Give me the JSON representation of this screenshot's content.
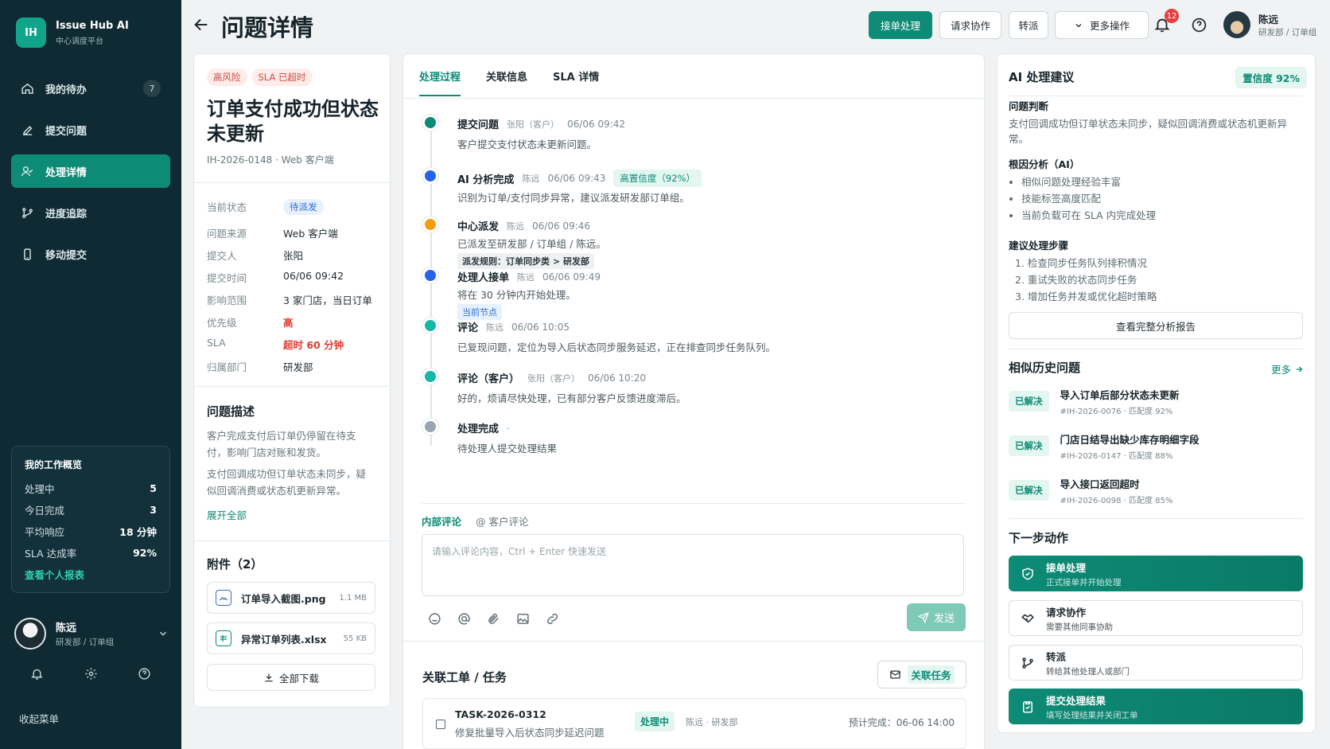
{
  "app": {
    "logo": "IH",
    "name": "Issue Hub AI",
    "subtitle": "中心调度平台"
  },
  "nav": [
    {
      "label": "我的待办",
      "icon": "home-icon",
      "badge": "7"
    },
    {
      "label": "提交问题",
      "icon": "pen-icon",
      "badge": ""
    },
    {
      "label": "处理详情",
      "icon": "user-check-icon",
      "badge": ""
    },
    {
      "label": "进度追踪",
      "icon": "branch-icon",
      "badge": ""
    },
    {
      "label": "移动提交",
      "icon": "mobile-icon",
      "badge": ""
    }
  ],
  "work": {
    "title": "我的工作概览",
    "rows": [
      {
        "label": "处理中",
        "value": "5"
      },
      {
        "label": "今日完成",
        "value": "3"
      },
      {
        "label": "平均响应",
        "value": "18 分钟"
      },
      {
        "label": "SLA 达成率",
        "value": "92%"
      }
    ],
    "link": "查看个人报表"
  },
  "user": {
    "name": "陈远",
    "dept": "研发部 / 订单组"
  },
  "sidebar_collapse": "收起菜单",
  "header": {
    "title": "问题详情",
    "btn_accept": "接单处理",
    "btn_collab": "请求协作",
    "btn_transfer": "转派",
    "btn_more": "更多操作",
    "notif_count": "12"
  },
  "issue": {
    "tags": [
      "高风险",
      "SLA 已超时"
    ],
    "title": "订单支付成功但状态未更新",
    "id": "IH-2026-0148 · Web 客户端",
    "props": [
      {
        "label": "当前状态",
        "value": "待派发"
      },
      {
        "label": "问题来源",
        "value": "Web 客户端"
      },
      {
        "label": "提交人",
        "value": "张阳"
      },
      {
        "label": "提交时间",
        "value": "06/06 09:42"
      },
      {
        "label": "影响范围",
        "value": "3 家门店，当日订单"
      },
      {
        "label": "优先级",
        "value": "高"
      },
      {
        "label": "SLA",
        "value": "超时 60 分钟"
      },
      {
        "label": "归属部门",
        "value": "研发部"
      }
    ],
    "desc_title": "问题描述",
    "desc1": "客户完成支付后订单仍停留在待支付，影响门店对账和发货。",
    "desc2": "支付回调成功但订单状态未同步，疑似回调消费或状态机更新异常。",
    "expand": "展开全部",
    "attach_title": "附件（2）",
    "attachments": [
      {
        "name": "订单导入截图.png",
        "size": "1.1 MB"
      },
      {
        "name": "异常订单列表.xlsx",
        "size": "55 KB"
      }
    ],
    "download_all": "全部下载"
  },
  "tabs": [
    "处理过程",
    "关联信息",
    "SLA 详情"
  ],
  "timeline": [
    {
      "title": "提交问题",
      "who": "张阳（客户）",
      "time": "06/06 09:42",
      "text": "客户提交支付状态未更新问题。",
      "color": "#0d8b76",
      "extra": ""
    },
    {
      "title": "AI 分析完成",
      "who": "陈远",
      "time": "06/06 09:43",
      "text": "识别为订单/支付同步异常，建议派发研发部订单组。",
      "color": "#2563eb",
      "extra": "高置信度（92%）"
    },
    {
      "title": "中心派发",
      "who": "陈远",
      "time": "06/06 09:46",
      "text": "已派发至研发部 / 订单组 / 陈远。",
      "color": "#f59e0b",
      "extra": "派发规则：订单同步类 > 研发部"
    },
    {
      "title": "处理人接单",
      "who": "陈远",
      "time": "06/06 09:49",
      "text": "将在 30 分钟内开始处理。",
      "color": "#2563eb",
      "extra": "当前节点"
    },
    {
      "title": "评论",
      "who": "陈远",
      "time": "06/06 10:05",
      "text": "已复现问题，定位为导入后状态同步服务延迟，正在排查同步任务队列。",
      "color": "#14b8a6",
      "extra": ""
    },
    {
      "title": "评论（客户）",
      "who": "张阳（客户）",
      "time": "06/06 10:20",
      "text": "好的，烦请尽快处理，已有部分客户反馈进度滞后。",
      "color": "#14b8a6",
      "extra": ""
    },
    {
      "title": "处理完成",
      "who": "-",
      "time": "",
      "text": "待处理人提交处理结果",
      "color": "#9aa5b4",
      "extra": ""
    }
  ],
  "comment": {
    "tab_internal": "内部评论",
    "tab_customer": "@ 客户评论",
    "placeholder": "请输入评论内容，Ctrl + Enter 快速发送",
    "send": "发送"
  },
  "related": {
    "title": "关联工单 / 任务",
    "btn": "关联任务",
    "task_id": "TASK-2026-0312",
    "task_desc": "修复批量导入后状态同步延迟问题",
    "task_status": "处理中",
    "task_owner": "陈远 · 研发部",
    "task_eta": "预计完成：06-06 14:00"
  },
  "ai": {
    "title": "AI 处理建议",
    "confidence": "置信度 92%",
    "judge_title": "问题判断",
    "judge": "支付回调成功但订单状态未同步，疑似回调消费或状态机更新异常。",
    "root_title": "根因分析（AI）",
    "root": [
      "相似问题处理经验丰富",
      "技能标签高度匹配",
      "当前负载可在 SLA 内完成处理"
    ],
    "steps_title": "建议处理步骤",
    "steps": [
      "1. 检查同步任务队列排积情况",
      "2. 重试失败的状态同步任务",
      "3. 增加任务并发或优化超时策略"
    ],
    "full_report": "查看完整分析报告"
  },
  "history": {
    "title": "相似历史问题",
    "more": "更多",
    "items": [
      {
        "status": "已解决",
        "title": "导入订单后部分状态未更新",
        "sub": "#IH-2026-0076 · 匹配度 92%"
      },
      {
        "status": "已解决",
        "title": "门店日结导出缺少库存明细字段",
        "sub": "#IH-2026-0147 · 匹配度 88%"
      },
      {
        "status": "已解决",
        "title": "导入接口返回超时",
        "sub": "#IH-2026-0098 · 匹配度 85%"
      }
    ]
  },
  "next": {
    "title": "下一步动作",
    "actions": [
      {
        "title": "接单处理",
        "sub": "正式接单并开始处理"
      },
      {
        "title": "请求协作",
        "sub": "需要其他同事协助"
      },
      {
        "title": "转派",
        "sub": "转给其他处理人或部门"
      },
      {
        "title": "提交处理结果",
        "sub": "填写处理结果并关闭工单"
      }
    ]
  },
  "colors": {
    "accent": "#0d8b76",
    "sidebar": "#0f2a33",
    "danger": "#e03a2f"
  }
}
